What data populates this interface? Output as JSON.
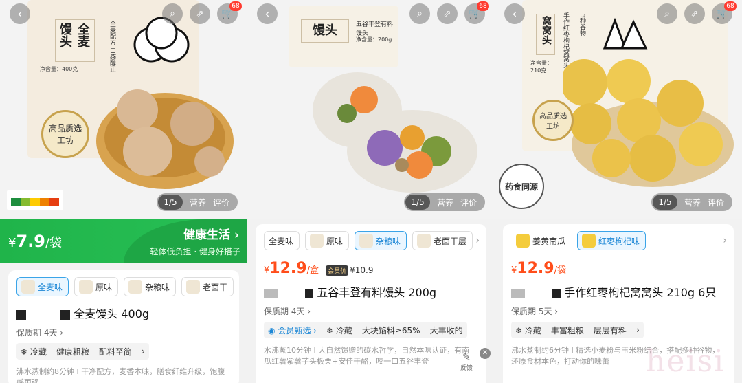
{
  "badge_count": "68",
  "pager": {
    "index": "1/5",
    "nutrition": "营养",
    "review": "评价"
  },
  "p1": {
    "package_title": "全麦馒头",
    "package_side": "全麦配方 口感醇正",
    "package_weight": "净含量：400克",
    "seal": "高品质选工坊",
    "price_symbol": "¥",
    "price": "7.9",
    "unit": "/袋",
    "headline": "健康生活",
    "headline_arrow": "›",
    "sub": "轻体低负担 · 健身好搭子",
    "flavors": [
      "全麦味",
      "原味",
      "杂粮味",
      "老面干"
    ],
    "title": "全麦馒头 400g",
    "shelf": "保质期 4天",
    "tags": [
      "冷藏",
      "健康粗粮",
      "配料至简"
    ],
    "desc": "沸水蒸制约8分钟 I 干净配方，麦香本味，膳食纤维升级，饱腹感更强"
  },
  "p2": {
    "package_title": "馒头",
    "package_side": "五谷丰登有料馒头",
    "package_weight": "净含量：200g",
    "flavors": [
      "全麦味",
      "原味",
      "杂粮味",
      "老面干层"
    ],
    "price_symbol": "¥",
    "price": "12.9",
    "unit": "/盒",
    "vip_tag": "会员价",
    "vip_price": "¥10.9",
    "title": "五谷丰登有料馒头 200g",
    "shelf": "保质期 4天",
    "tags": [
      "会员甄选",
      "冷藏",
      "大块馅料≥65%",
      "大丰收的"
    ],
    "desc": "水沸蒸10分钟 I 大自然馈赠的碳水哲学，自然本味认证，有南瓜红薯紫薯芋头板栗+安佳干酪，咬一口五谷丰登"
  },
  "p3": {
    "package_title": "窝窝头",
    "package_side": "手作红枣枸杞窝窝头",
    "package_weight": "净含量：210克",
    "package_note": "3种谷物",
    "seal": "高品质选工坊",
    "stamp": "药食同源",
    "flavors": [
      "姜黄南瓜",
      "红枣枸杞味"
    ],
    "price_symbol": "¥",
    "price": "12.9",
    "unit": "/袋",
    "title": "手作红枣枸杞窝窝头 210g 6只",
    "shelf": "保质期 5天",
    "tags": [
      "冷藏",
      "丰富粗粮",
      "层层有料"
    ],
    "desc": "沸水蒸制约6分钟 I 精选小麦粉与玉米粉结合，搭配多种谷物，还原食材本色，打动你的味蕾"
  },
  "feedback": "反馈",
  "watermark": "heisi",
  "colors": {
    "green": "#20b44a",
    "price_red": "#ff4d1a",
    "blue": "#1e88d6"
  }
}
